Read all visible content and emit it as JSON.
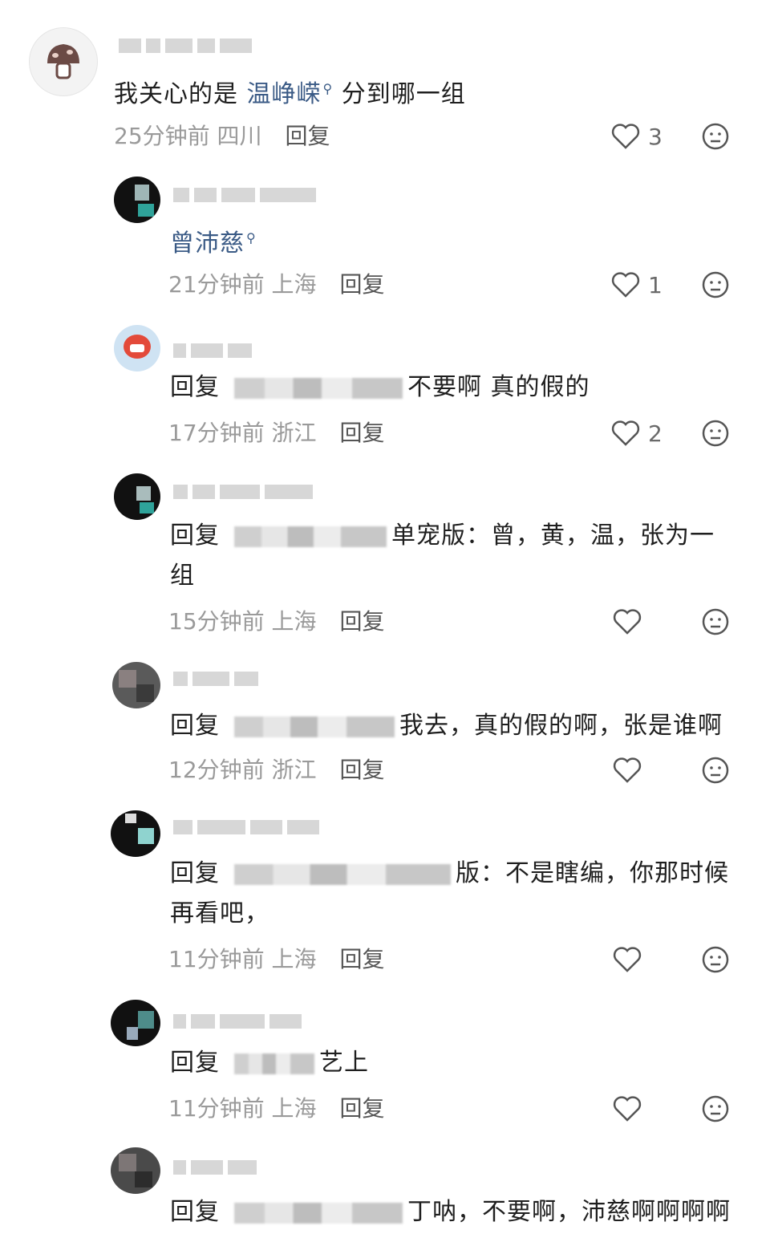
{
  "comments": [
    {
      "content_parts": {
        "text_before": "我关心的是 ",
        "keyword": "温峥嵘",
        "text_after": " 分到哪一组"
      },
      "time": "25分钟前",
      "location": "四川",
      "reply_label": "回复",
      "likes": "3"
    },
    {
      "content_parts": {
        "keyword": "曾沛慈"
      },
      "time": "21分钟前",
      "location": "上海",
      "reply_label": "回复",
      "likes": "1"
    },
    {
      "reply_prefix": "回复",
      "content": "不要啊 真的假的",
      "time": "17分钟前",
      "location": "浙江",
      "reply_label": "回复",
      "likes": "2"
    },
    {
      "reply_prefix": "回复",
      "content_line1": "单宠版：曾，黄，温，张为一",
      "content_line2": "组",
      "time": "15分钟前",
      "location": "上海",
      "reply_label": "回复",
      "likes": ""
    },
    {
      "reply_prefix": "回复",
      "content": "我去，真的假的啊，张是谁啊",
      "time": "12分钟前",
      "location": "浙江",
      "reply_label": "回复",
      "likes": ""
    },
    {
      "reply_prefix": "回复",
      "content_line1": "版：不是瞎编，你那时候",
      "content_line2": "再看吧，",
      "time": "11分钟前",
      "location": "上海",
      "reply_label": "回复",
      "likes": ""
    },
    {
      "reply_prefix": "回复",
      "content": "艺上",
      "time": "11分钟前",
      "location": "上海",
      "reply_label": "回复",
      "likes": ""
    },
    {
      "reply_prefix": "回复",
      "content": "丁呐，不要啊，沛慈啊啊啊啊"
    }
  ],
  "colors": {
    "link": "#3b5b86",
    "meta": "#9a9a9a",
    "text": "#1f1f1f"
  }
}
